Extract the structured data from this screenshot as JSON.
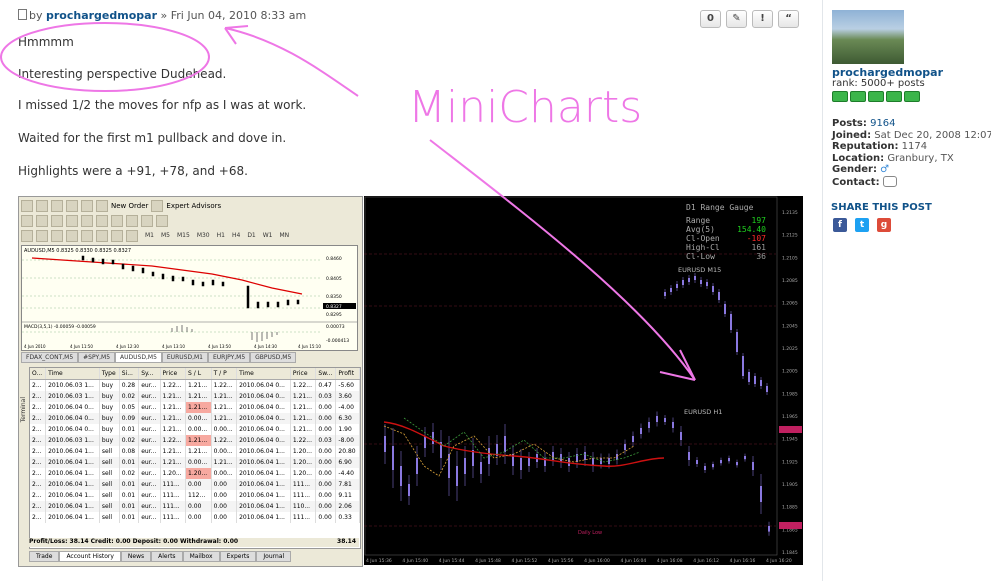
{
  "post": {
    "by_prefix": "by",
    "author": "prochargedmopar",
    "date": "» Fri Jun 04, 2010 8:33 am",
    "lines": [
      "Hmmmm",
      "Interesting perspective Dudehead.",
      "I missed 1/2 the moves for nfp as I was at work.",
      "Waited for the first m1 pullback and dove in.",
      "Highlights were a +91, +78, and +68."
    ],
    "buttons": [
      "0",
      "✎",
      "!",
      "“"
    ],
    "annotation": "MiniCharts"
  },
  "profile": {
    "username": "prochargedmopar",
    "rank": "rank: 5000+ posts",
    "posts_label": "Posts:",
    "posts": "9164",
    "joined_label": "Joined:",
    "joined": "Sat Dec 20, 2008 12:07 am",
    "reputation_label": "Reputation:",
    "reputation": "1174",
    "location_label": "Location:",
    "location": "Granbury, TX",
    "gender_label": "Gender:",
    "contact_label": "Contact:",
    "share": "SHARE THIS POST"
  },
  "mt4": {
    "toolbar1": [
      "New Order",
      "Expert Advisors"
    ],
    "timeframes": [
      "M1",
      "M5",
      "M15",
      "M30",
      "H1",
      "H4",
      "D1",
      "W1",
      "MN"
    ],
    "chart_header": "AUDUSD,M5  0.8325 0.8330 0.8325 0.8327",
    "indicator_label": "MACD(3,5,1) -0.00059 -0.00059",
    "chart_prices": [
      "0.8460",
      "0.8405",
      "0.8350",
      "0.8327",
      "0.8295",
      "0.00073",
      "-0.000413"
    ],
    "chart_times": [
      "4 Jun 2010",
      "4 Jun 11:50",
      "4 Jun 12:30",
      "4 Jun 13:10",
      "4 Jun 13:50",
      "4 Jun 14:30",
      "4 Jun 15:10"
    ],
    "chart_tabs": [
      "FDAX_CONT,M5",
      "#SPY,M5",
      "AUDUSD,M5",
      "EURUSD,M1",
      "EURJPY,M5",
      "GBPUSD,M5"
    ],
    "columns": [
      "O...",
      "Time",
      "Type",
      "Si...",
      "Sy...",
      "Price",
      "S / L",
      "T / P",
      "Time",
      "Price",
      "Sw...",
      "Profit"
    ],
    "rows": [
      [
        "2...",
        "2010.06.03 1...",
        "buy",
        "0.28",
        "eur...",
        "1.22...",
        "1.21...",
        "1.22...",
        "2010.06.04 0...",
        "1.22...",
        "0.47",
        "-5.60"
      ],
      [
        "2...",
        "2010.06.03 1...",
        "buy",
        "0.02",
        "eur...",
        "1.21...",
        "1.21...",
        "1.21...",
        "2010.06.04 0...",
        "1.21...",
        "0.03",
        "3.60"
      ],
      [
        "2...",
        "2010.06.04 0...",
        "buy",
        "0.05",
        "eur...",
        "1.21...",
        "1.21...",
        "1.21...",
        "2010.06.04 0...",
        "1.21...",
        "0.00",
        "-4.00"
      ],
      [
        "2...",
        "2010.06.04 0...",
        "buy",
        "0.09",
        "eur...",
        "1.21...",
        "0.00...",
        "1.21...",
        "2010.06.04 0...",
        "1.21...",
        "0.00",
        "6.30"
      ],
      [
        "2...",
        "2010.06.04 0...",
        "buy",
        "0.01",
        "eur...",
        "1.21...",
        "0.00...",
        "0.00...",
        "2010.06.04 0...",
        "1.21...",
        "0.00",
        "1.90"
      ],
      [
        "2...",
        "2010.06.03 1...",
        "buy",
        "0.02",
        "eur...",
        "1.22...",
        "1.21...",
        "1.22...",
        "2010.06.04 0...",
        "1.22...",
        "0.03",
        "-8.00"
      ],
      [
        "2...",
        "2010.06.04 1...",
        "sell",
        "0.08",
        "eur...",
        "1.21...",
        "1.21...",
        "0.00...",
        "2010.06.04 1...",
        "1.20...",
        "0.00",
        "20.80"
      ],
      [
        "2...",
        "2010.06.04 1...",
        "sell",
        "0.01",
        "eur...",
        "1.21...",
        "0.00...",
        "1.21...",
        "2010.06.04 1...",
        "1.20...",
        "0.00",
        "6.90"
      ],
      [
        "2...",
        "2010.06.04 1...",
        "sell",
        "0.02",
        "eur...",
        "1.20...",
        "1.20...",
        "0.00...",
        "2010.06.04 1...",
        "1.20...",
        "0.00",
        "-4.40"
      ],
      [
        "2...",
        "2010.06.04 1...",
        "sell",
        "0.01",
        "eur...",
        "111...",
        "0.00",
        "0.00",
        "2010.06.04 1...",
        "111...",
        "0.00",
        "7.81"
      ],
      [
        "2...",
        "2010.06.04 1...",
        "sell",
        "0.01",
        "eur...",
        "111...",
        "112...",
        "0.00",
        "2010.06.04 1...",
        "111...",
        "0.00",
        "9.11"
      ],
      [
        "2...",
        "2010.06.04 1...",
        "sell",
        "0.01",
        "eur...",
        "111...",
        "0.00",
        "0.00",
        "2010.06.04 1...",
        "110...",
        "0.00",
        "2.06"
      ],
      [
        "2...",
        "2010.06.04 1...",
        "sell",
        "0.01",
        "eur...",
        "111...",
        "0.00",
        "0.00",
        "2010.06.04 1...",
        "111...",
        "0.00",
        "0.33"
      ]
    ],
    "pnl": "Profit/Loss: 38.14  Credit: 0.00  Deposit: 0.00  Withdrawal: 0.00",
    "pnl_total": "38.14",
    "bottom_tabs": [
      "Trade",
      "Account History",
      "News",
      "Alerts",
      "Mailbox",
      "Experts",
      "Journal"
    ],
    "terminal_label": "Terminal"
  },
  "bigchart": {
    "gauge_title": "D1 Range Gauge",
    "gauge_rows": [
      {
        "label": "Range",
        "value": "197",
        "color": "#1fd11f"
      },
      {
        "label": "Avg(5)",
        "value": "154.40",
        "color": "#1fd11f"
      },
      {
        "label": "Cl-Open",
        "value": "-107",
        "color": "#ff2a2a"
      },
      {
        "label": "High-Cl",
        "value": "161",
        "color": "#9a9a9a"
      },
      {
        "label": "Cl-Low",
        "value": "36",
        "color": "#9a9a9a"
      }
    ],
    "label_m15": "EURUSD M15",
    "label_h1": "EURUSD H1",
    "daily_low": "Daily Low",
    "prices": [
      "1.2135",
      "1.2125",
      "1.2105",
      "1.2085",
      "1.2065",
      "1.2045",
      "1.2025",
      "1.2005",
      "1.1985",
      "1.1965",
      "1.1945",
      "1.1925",
      "1.1905",
      "1.1885",
      "1.1865",
      "1.1845"
    ],
    "times": [
      "4 Jun 15:36",
      "4 Jun 15:40",
      "4 Jun 15:44",
      "4 Jun 15:48",
      "4 Jun 15:52",
      "4 Jun 15:56",
      "4 Jun 16:00",
      "4 Jun 16:04",
      "4 Jun 16:08",
      "4 Jun 16:12",
      "4 Jun 16:16",
      "4 Jun 16:20"
    ]
  }
}
